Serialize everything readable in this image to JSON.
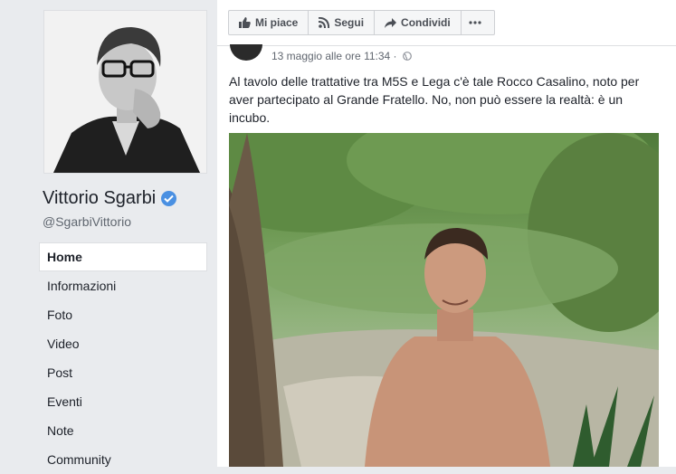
{
  "sidebar": {
    "page_name": "Vittorio Sgarbi",
    "handle": "@SgarbiVittorio",
    "nav": [
      {
        "label": "Home",
        "active": true
      },
      {
        "label": "Informazioni",
        "active": false
      },
      {
        "label": "Foto",
        "active": false
      },
      {
        "label": "Video",
        "active": false
      },
      {
        "label": "Post",
        "active": false
      },
      {
        "label": "Eventi",
        "active": false
      },
      {
        "label": "Note",
        "active": false
      },
      {
        "label": "Community",
        "active": false
      }
    ]
  },
  "actions": {
    "like_label": "Mi piace",
    "follow_label": "Segui",
    "share_label": "Condividi",
    "more_icon": "more-icon"
  },
  "post": {
    "date": "13 maggio alle ore 11:34 ·",
    "text": "Al tavolo delle trattative tra M5S e Lega c'è tale Rocco Casalino, noto per aver partecipato al Grande Fratello. No, non può essere la realtà: è un incubo."
  },
  "colors": {
    "background": "#e9ebee",
    "verified_badge": "#4a90e2",
    "text_primary": "#1d2129",
    "text_secondary": "#606770"
  }
}
